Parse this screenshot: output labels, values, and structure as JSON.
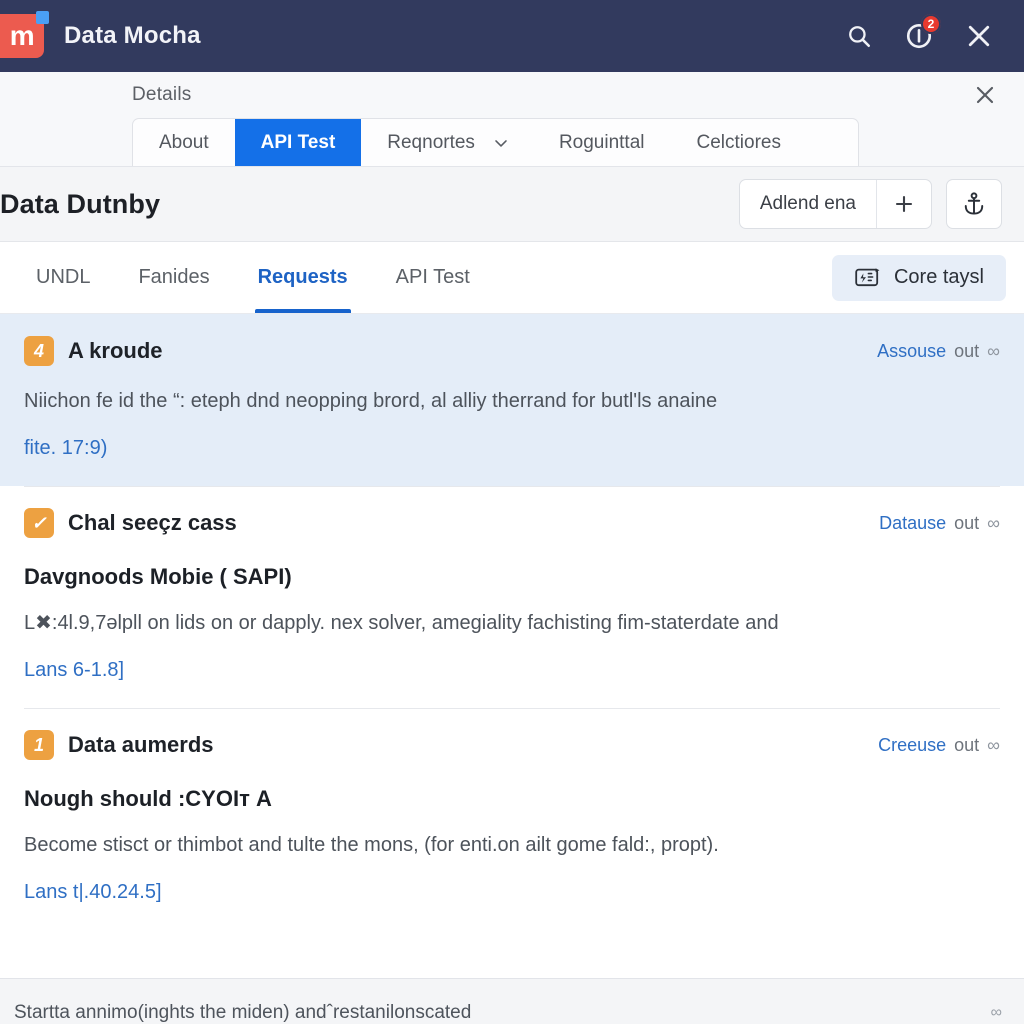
{
  "titlebar": {
    "logo_letter": "m",
    "logo_color": "#ec5b4f",
    "accent_dot_color": "#4a9ff5",
    "background": "#323a5e",
    "app_title": "Data Mocha",
    "search_icon": "search-icon",
    "info_icon": "info-circle-icon",
    "notification_count": "2",
    "notification_color": "#e8392f",
    "close_icon": "close-icon"
  },
  "details": {
    "label": "Details",
    "close_icon": "close-icon",
    "tabs": [
      {
        "label": "About",
        "active": false
      },
      {
        "label": "API Test",
        "active": true
      },
      {
        "label": "Reqnortes",
        "active": false,
        "caret": true
      },
      {
        "label": "Roguinttal",
        "active": false
      },
      {
        "label": "Celctiores",
        "active": false
      }
    ],
    "active_tab_color": "#1470e8"
  },
  "page_header": {
    "title": "Data Dutnby",
    "segmented_button": {
      "label": "Adlend ena",
      "plus_label": "+"
    },
    "anchor_button_icon": "anchor-icon"
  },
  "subnav": {
    "items": [
      {
        "label": "UNDL",
        "active": false
      },
      {
        "label": "Fanides",
        "active": false
      },
      {
        "label": "Requests",
        "active": true
      },
      {
        "label": "API Test",
        "active": false
      }
    ],
    "active_color": "#1763cc",
    "action_button": {
      "label": "Core taysl",
      "icon": "card-flash-icon",
      "background": "#e7eef8"
    }
  },
  "list": {
    "items": [
      {
        "badge": "4",
        "badge_color": "#eda141",
        "title": "A kroude",
        "link_primary": "Assouse",
        "link_secondary": "out",
        "link_icon": "infinity-link-icon",
        "subtitle": "",
        "body": "Νiichon fe id the “: eteph dnd neopping brord, al alliy therrand for butl'ls anaine",
        "reference": "fite. 17:9)",
        "highlight": true
      },
      {
        "badge": "✓",
        "badge_color": "#eda141",
        "title": "Chal seeçz cass",
        "link_primary": "Datause",
        "link_secondary": "out",
        "link_icon": "infinity-link-icon",
        "subtitle": "Davgnoods Mobie ( SAPI)",
        "body": "L✖:4l.9,7əlpll on lids on or dapply. nex solver, amegiality fachisting fim-staterdate and",
        "reference": "Lans 6-1.8]",
        "highlight": false
      },
      {
        "badge": "1",
        "badge_color": "#eda141",
        "title": "Data aumerds",
        "link_primary": "Creeuse",
        "link_secondary": "out",
        "link_icon": "infinity-link-icon",
        "subtitle": "Nough should :CYOIт A",
        "body": "Become stisct or thimbot and tulte the mons, (for enti.on ailt gome fald:, propt).",
        "reference": "Lans t|.40.24.5]",
        "highlight": false
      }
    ]
  },
  "bottom": {
    "text": "Startta annimo(inghts the miden) andˆrestanilonscated",
    "icon": "infinity-link-icon"
  }
}
